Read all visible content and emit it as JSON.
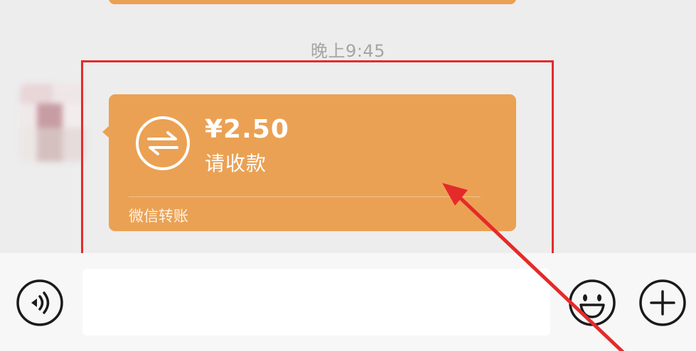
{
  "timestamp": "晚上9:45",
  "transfer_message": {
    "amount": "¥2.50",
    "status": "请收款",
    "footer": "微信转账",
    "bubble_color": "#eba153"
  },
  "annotation": {
    "highlight_color": "#e52a2a"
  },
  "input_bar": {
    "voice_button_icon": "voice-icon",
    "emoji_button_icon": "smiley-icon",
    "more_button_icon": "plus-icon"
  }
}
